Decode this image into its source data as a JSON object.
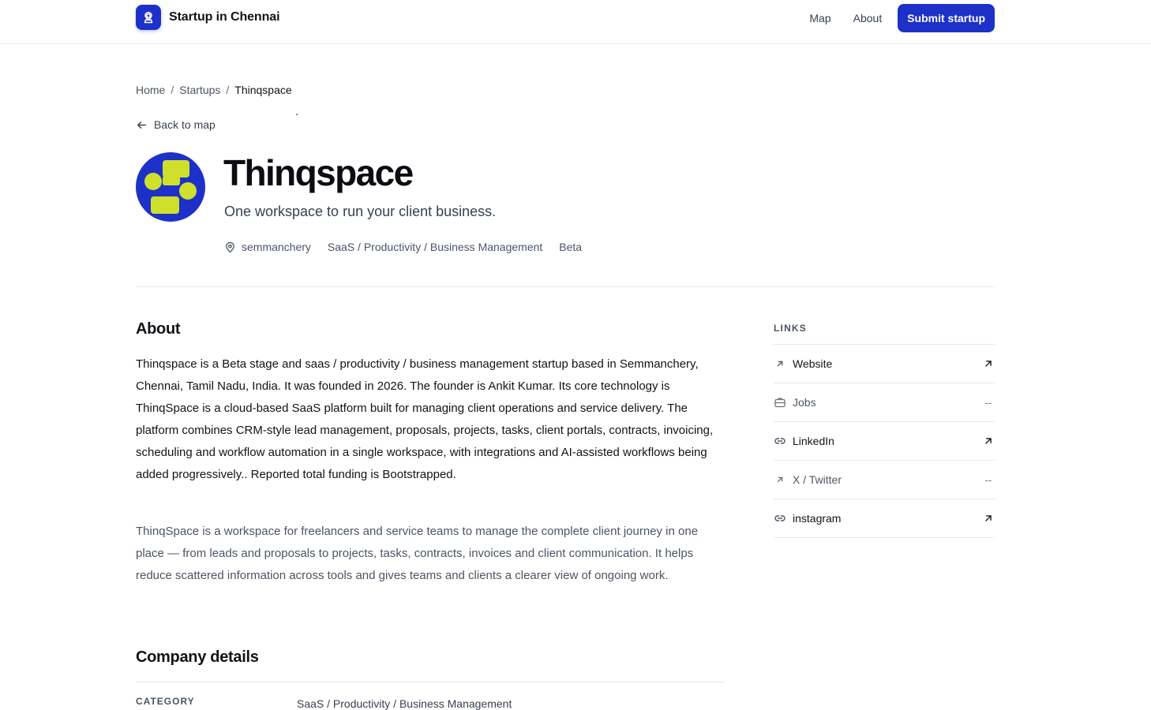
{
  "header": {
    "brand": "Startup in Chennai",
    "nav": {
      "map": "Map",
      "about": "About"
    },
    "submit_label": "Submit startup"
  },
  "breadcrumb": {
    "home": "Home",
    "startups": "Startups",
    "current": "Thinqspace",
    "separator": "/"
  },
  "back_label": "Back to map",
  "company": {
    "name": "Thinqspace",
    "tagline": "One workspace to run your client business.",
    "location": "semmanchery",
    "category": "SaaS / Productivity / Business Management",
    "stage": "Beta"
  },
  "about": {
    "title": "About",
    "paragraph_1": "Thinqspace is a Beta stage and saas / productivity / business management startup based in Semmanchery, Chennai, Tamil Nadu, India. It was founded in 2026. The founder is Ankit Kumar. Its core technology is ThinqSpace is a cloud-based SaaS platform built for managing client operations and service delivery. The platform combines CRM-style lead management, proposals, projects, tasks, client portals, contracts, invoicing, scheduling and workflow automation in a single workspace, with integrations and AI-assisted workflows being added progressively.. Reported total funding is Bootstrapped.",
    "paragraph_2": "ThinqSpace is a workspace for freelancers and service teams to manage the complete client journey in one place — from leads and proposals to projects, tasks, contracts, invoices and client communication. It helps reduce scattered information across tools and gives teams and clients a clearer view of ongoing work."
  },
  "details": {
    "title": "Company details",
    "rows": [
      {
        "key": "CATEGORY",
        "value": "SaaS / Productivity / Business Management"
      }
    ]
  },
  "links": {
    "heading": "LINKS",
    "items": [
      {
        "label": "Website",
        "icon": "arrow-up-right-icon",
        "end": "external-link-icon"
      },
      {
        "label": "Jobs",
        "icon": "briefcase-icon",
        "end": "--"
      },
      {
        "label": "LinkedIn",
        "icon": "link-icon",
        "end": "external-link-icon"
      },
      {
        "label": "X / Twitter",
        "icon": "arrow-up-right-icon",
        "end": "--"
      },
      {
        "label": "instagram",
        "icon": "link-icon",
        "end": "external-link-icon"
      }
    ]
  },
  "colors": {
    "brand": "#1d31c9",
    "logo_accent": "#cfe02c",
    "divider": "#e5e7eb"
  }
}
